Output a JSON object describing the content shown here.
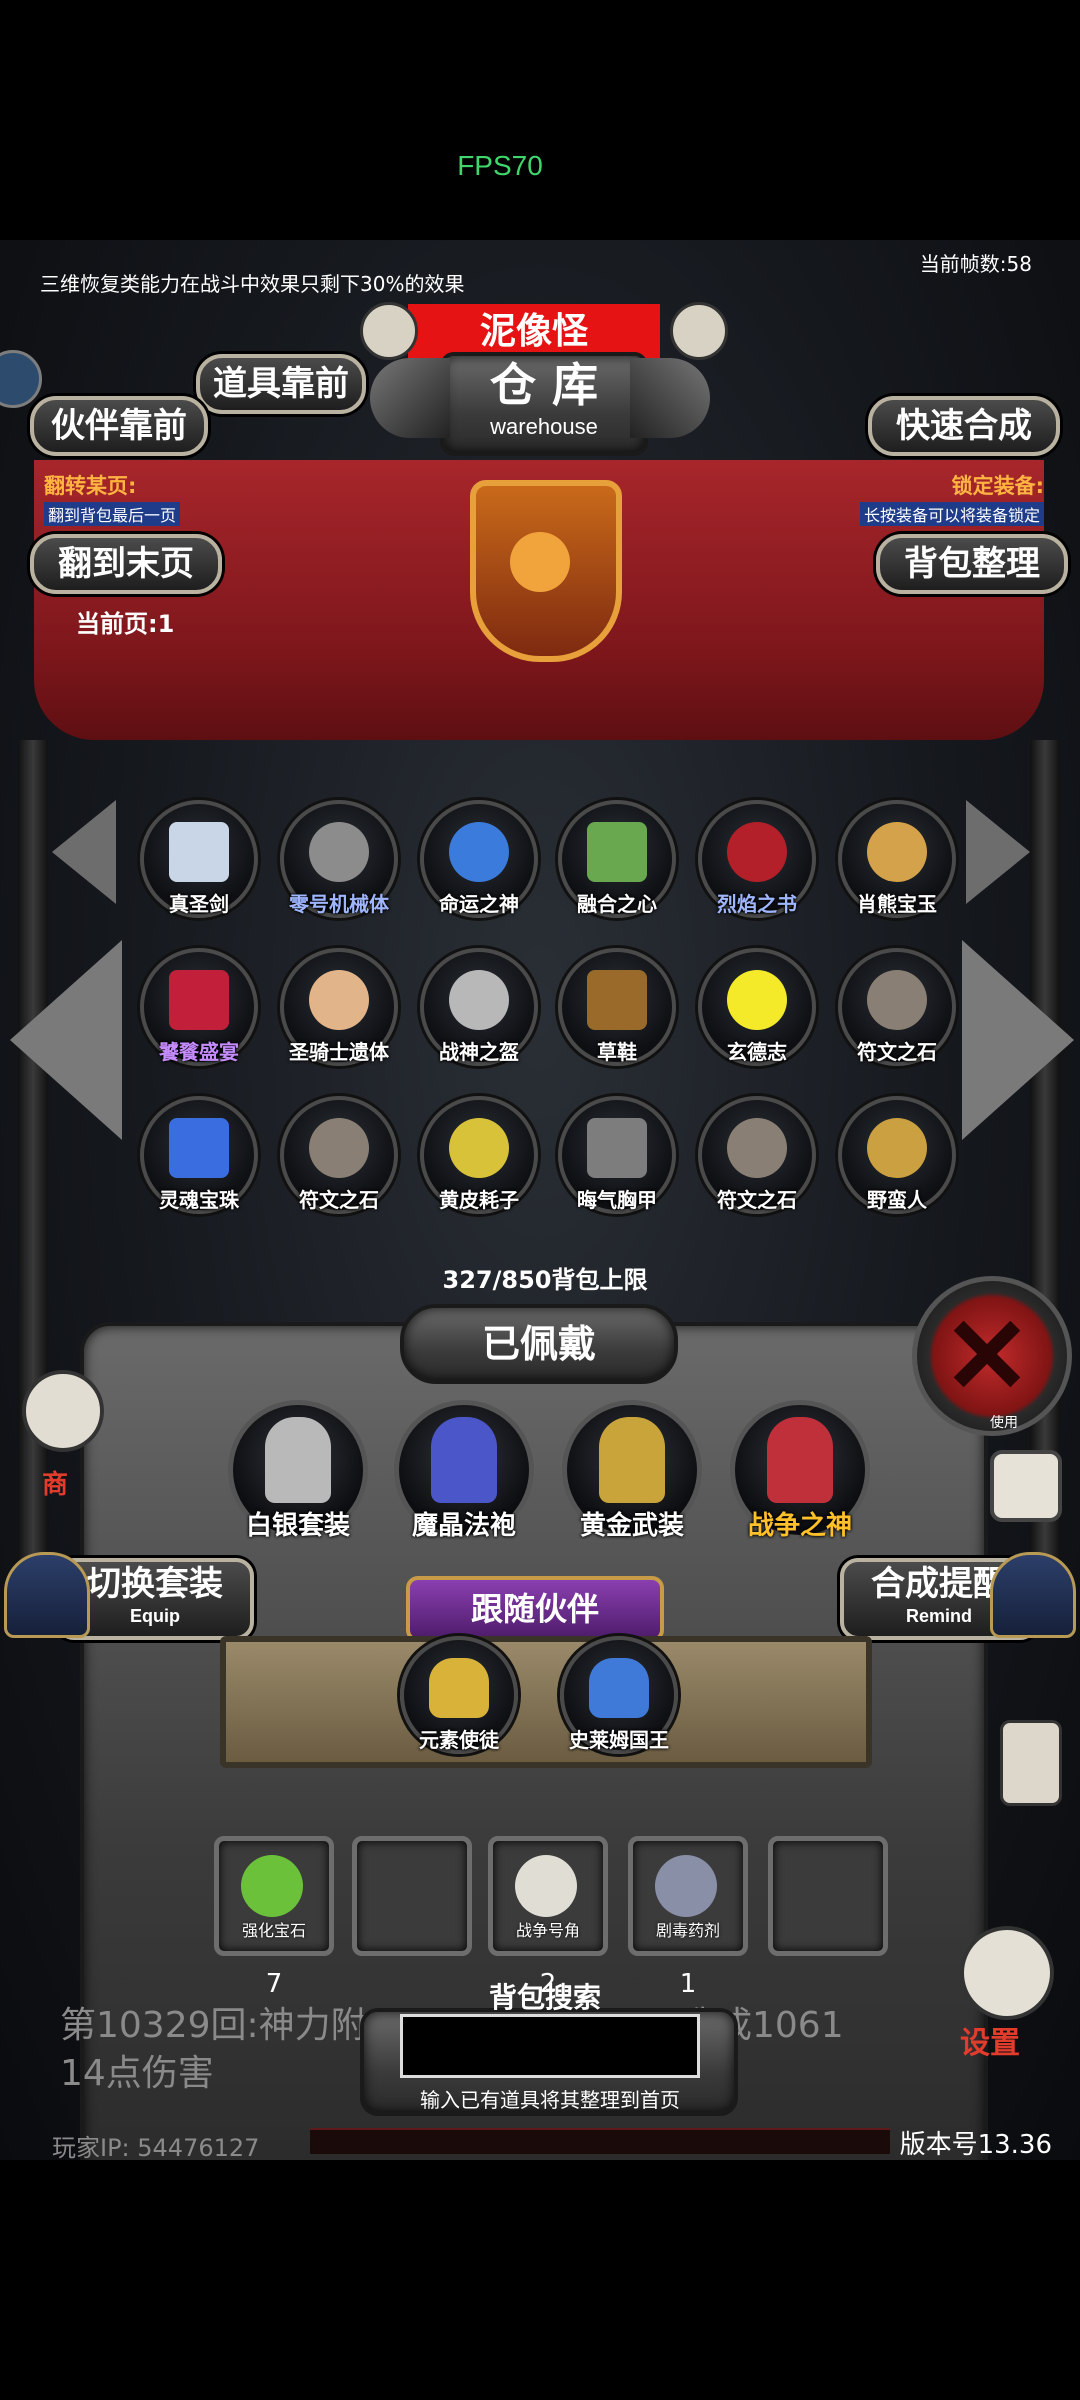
{
  "status": {
    "fps": "FPS70"
  },
  "header": {
    "notice": "三维恢复类能力在战斗中效果只剩下30%的效果",
    "frame_count": "当前帧数:58",
    "monster_name": "泥像怪",
    "warehouse_title": "仓 库",
    "warehouse_subtitle": "warehouse"
  },
  "buttons": {
    "item_front": "道具靠前",
    "partner_front": "伙伴靠前",
    "quick_synth": "快速合成",
    "to_last_page": "翻到末页",
    "bag_sort": "背包整理",
    "switch_set": "切换套装",
    "switch_set_sub": "Equip",
    "synth_remind": "合成提醒",
    "synth_remind_sub": "Remind",
    "shop": "商",
    "settings": "设置",
    "use": "使用"
  },
  "banner": {
    "flip_label": "翻转某页:",
    "flip_desc": "翻到背包最后一页",
    "lock_label": "锁定装备:",
    "lock_desc": "长按装备可以将装备锁定",
    "current_page": "当前页:1"
  },
  "grid": [
    {
      "label": "真圣剑",
      "icon": "sword-icon",
      "color": "#ffffff"
    },
    {
      "label": "零号机械体",
      "icon": "robot-icon",
      "color": "#9fb6ff"
    },
    {
      "label": "命运之神",
      "icon": "necklace-icon",
      "color": "#ffffff"
    },
    {
      "label": "融合之心",
      "icon": "fruit-icon",
      "color": "#ffffff"
    },
    {
      "label": "烈焰之书",
      "icon": "book-icon",
      "color": "#9fb6ff"
    },
    {
      "label": "肖熊宝玉",
      "icon": "pendant-icon",
      "color": "#ffffff"
    },
    {
      "label": "饕餮盛宴",
      "icon": "demon-mask-icon",
      "color": "#c58cff"
    },
    {
      "label": "圣骑士遗体",
      "icon": "body-icon",
      "color": "#ffffff"
    },
    {
      "label": "战神之盔",
      "icon": "helmet-icon",
      "color": "#ffffff"
    },
    {
      "label": "草鞋",
      "icon": "boots-icon",
      "color": "#ffffff"
    },
    {
      "label": "玄德志",
      "icon": "scroll-icon",
      "color": "#ffffff"
    },
    {
      "label": "符文之石",
      "icon": "rune-stone-icon",
      "color": "#ffffff"
    },
    {
      "label": "灵魂宝珠",
      "icon": "orb-icon",
      "color": "#ffffff"
    },
    {
      "label": "符文之石",
      "icon": "rune-stone-icon",
      "color": "#ffffff"
    },
    {
      "label": "黄皮耗子",
      "icon": "rat-icon",
      "color": "#ffffff"
    },
    {
      "label": "晦气胸甲",
      "icon": "chestplate-icon",
      "color": "#ffffff"
    },
    {
      "label": "符文之石",
      "icon": "rune-stone-icon",
      "color": "#ffffff"
    },
    {
      "label": "野蛮人",
      "icon": "barbarian-icon",
      "color": "#ffffff"
    }
  ],
  "bag_limit": "327/850背包上限",
  "equipped": {
    "title": "已佩戴",
    "items": [
      {
        "label": "白银套装",
        "icon": "silver-armor-icon",
        "color": "#ffffff"
      },
      {
        "label": "魔晶法袍",
        "icon": "robe-icon",
        "color": "#ffffff"
      },
      {
        "label": "黄金武装",
        "icon": "gold-armor-icon",
        "color": "#ffffff"
      },
      {
        "label": "战争之神",
        "icon": "war-god-icon",
        "color": "#ffc02a"
      }
    ]
  },
  "partners": {
    "title": "跟随伙伴",
    "items": [
      {
        "label": "元素使徒",
        "icon": "elemental-icon"
      },
      {
        "label": "史莱姆国王",
        "icon": "slime-icon"
      }
    ]
  },
  "consumables": [
    {
      "label": "强化宝石",
      "count": "7",
      "icon": "gem-icon"
    },
    {
      "label": "",
      "count": "",
      "icon": ""
    },
    {
      "label": "战争号角",
      "count": "2",
      "icon": "horn-icon"
    },
    {
      "label": "剧毒药剂",
      "count": "1",
      "icon": "potion-icon"
    },
    {
      "label": "",
      "count": "",
      "icon": ""
    }
  ],
  "log": {
    "line1a": "第10329回:神力附",
    "line1b": "造成1061",
    "line2": "14点伤害"
  },
  "search": {
    "title": "背包搜索",
    "placeholder": "",
    "hint": "输入已有道具将其整理到首页"
  },
  "footer": {
    "player_ip": "玩家IP:  54476127",
    "version": "版本号13.36"
  }
}
